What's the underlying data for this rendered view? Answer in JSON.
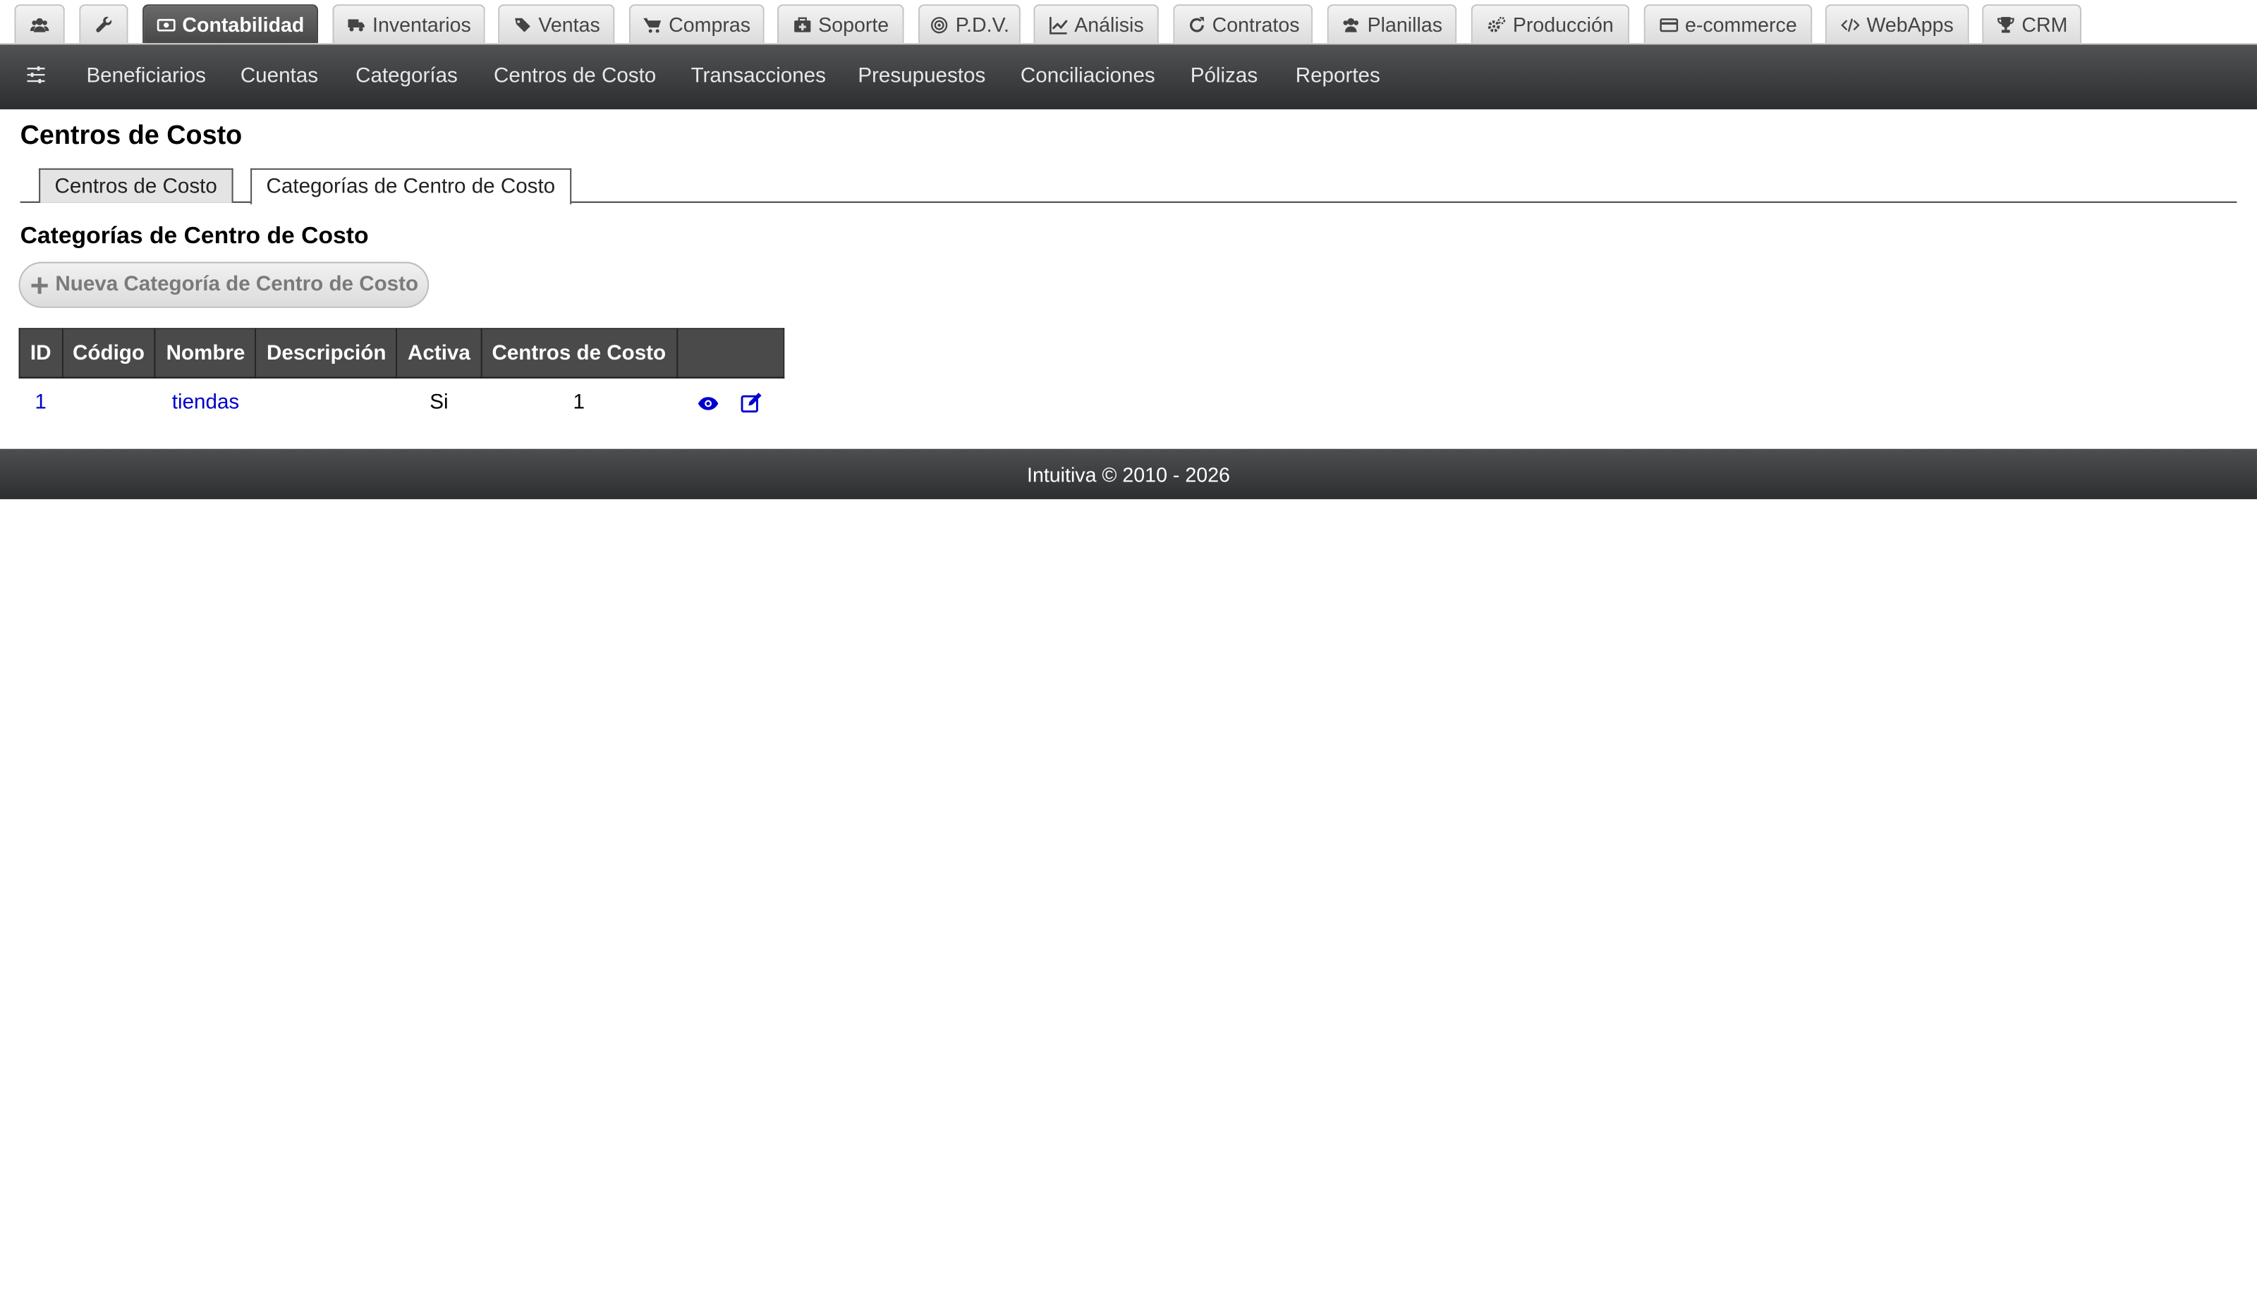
{
  "modules": [
    {
      "label": "",
      "icon": "users-icon"
    },
    {
      "label": "",
      "icon": "wrench-icon"
    },
    {
      "label": "Contabilidad",
      "icon": "money-icon",
      "active": true
    },
    {
      "label": "Inventarios",
      "icon": "truck-icon"
    },
    {
      "label": "Ventas",
      "icon": "tags-icon"
    },
    {
      "label": "Compras",
      "icon": "cart-icon"
    },
    {
      "label": "Soporte",
      "icon": "medkit-icon"
    },
    {
      "label": "P.D.V.",
      "icon": "target-icon"
    },
    {
      "label": "Análisis",
      "icon": "chart-line-icon"
    },
    {
      "label": "Contratos",
      "icon": "refresh-icon"
    },
    {
      "label": "Planillas",
      "icon": "users-icon"
    },
    {
      "label": "Producción",
      "icon": "cogs-icon"
    },
    {
      "label": "e-commerce",
      "icon": "credit-card-icon"
    },
    {
      "label": "WebApps",
      "icon": "code-icon"
    },
    {
      "label": "CRM",
      "icon": "trophy-icon"
    }
  ],
  "subnav": {
    "icon": "sliders-icon",
    "items": [
      "Beneficiarios",
      "Cuentas",
      "Categorías",
      "Centros de Costo",
      "Transacciones",
      "Presupuestos",
      "Conciliaciones",
      "Pólizas",
      "Reportes"
    ]
  },
  "page": {
    "title": "Centros de Costo",
    "tabs": [
      "Centros de Costo",
      "Categorías de Centro de Costo"
    ],
    "active_tab": 1,
    "section_title": "Categorías de Centro de Costo",
    "new_button": "Nueva Categoría de Centro de Costo"
  },
  "table": {
    "headers": [
      "ID",
      "Código",
      "Nombre",
      "Descripción",
      "Activa",
      "Centros de Costo",
      ""
    ],
    "rows": [
      {
        "id": "1",
        "codigo": "",
        "nombre": "tiendas",
        "descripcion": "",
        "activa": "Si",
        "centros": "1"
      }
    ],
    "row_actions": [
      "eye-icon",
      "edit-icon"
    ]
  },
  "footer": {
    "text": "Intuitiva © 2010 - 2026"
  },
  "colors": {
    "link": "#0000cc",
    "navbar": "#3a3c3d",
    "active_tab": "#555555"
  }
}
